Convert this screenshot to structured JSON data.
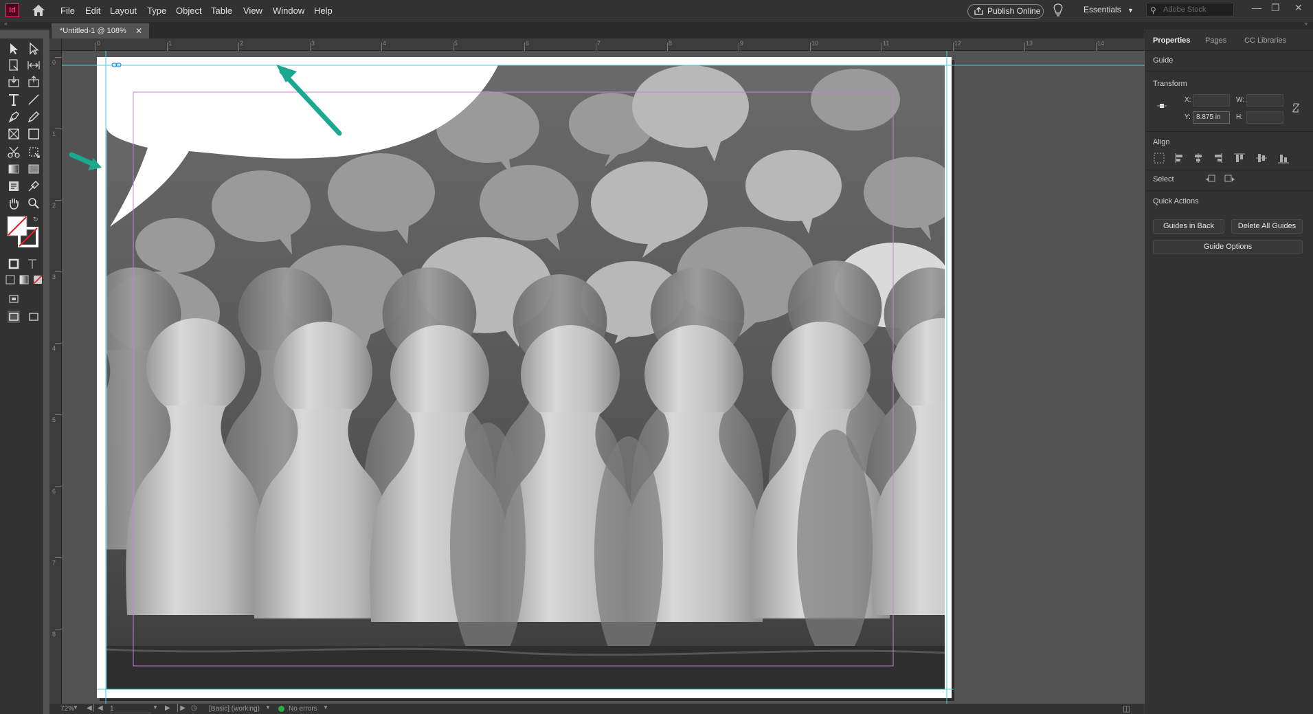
{
  "app": {
    "logo": "Id",
    "menus": [
      "File",
      "Edit",
      "Layout",
      "Type",
      "Object",
      "Table",
      "View",
      "Window",
      "Help"
    ],
    "publish_label": "Publish Online",
    "workspace": "Essentials",
    "search_placeholder": "Adobe Stock"
  },
  "document": {
    "tab_title": "*Untitled-1 @ 108%",
    "ruler_h": [
      "0",
      "1",
      "2",
      "3",
      "4",
      "5",
      "6",
      "7",
      "8",
      "9",
      "10",
      "11",
      "12",
      "13",
      "14"
    ],
    "ruler_v": [
      "0",
      "1",
      "2",
      "3",
      "4",
      "5",
      "6",
      "7",
      "8"
    ]
  },
  "status": {
    "zoom": "72%",
    "page": "1",
    "preflight_profile": "[Basic] (working)",
    "errors": "No errors"
  },
  "panel": {
    "tabs": [
      "Properties",
      "Pages",
      "CC Libraries"
    ],
    "selection": "Guide",
    "transform_label": "Transform",
    "x_label": "X:",
    "y_label": "Y:",
    "w_label": "W:",
    "h_label": "H:",
    "x_value": "",
    "y_value": "8.875 in",
    "align_label": "Align",
    "select_label": "Select",
    "quick_actions_label": "Quick Actions",
    "guides_in_back": "Guides in Back",
    "delete_all_guides": "Delete All Guides",
    "guide_options": "Guide Options"
  },
  "colors": {
    "accent_arrow": "#1aa890",
    "guide_cyan": "#3fd0e6",
    "margin_magenta": "#c77fd7",
    "app_bg": "#535353"
  }
}
